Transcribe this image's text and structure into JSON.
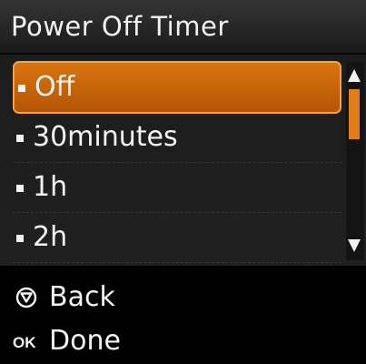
{
  "title": "Power Off Timer",
  "menu": {
    "items": [
      {
        "label": "Off",
        "selected": true
      },
      {
        "label": "30minutes",
        "selected": false
      },
      {
        "label": "1h",
        "selected": false
      },
      {
        "label": "2h",
        "selected": false
      }
    ]
  },
  "scrollbar": {
    "position_fraction": 0,
    "visible_fraction": 0.35
  },
  "footer": {
    "back_label": "Back",
    "done_label": "Done",
    "back_icon": "stop-icon",
    "done_icon": "ok-icon",
    "ok_glyph": "OK"
  },
  "colors": {
    "accent": "#d8740e",
    "accent_border": "#f2a24a",
    "scroll_thumb": "#e07c19",
    "text": "#f4f4f4"
  }
}
